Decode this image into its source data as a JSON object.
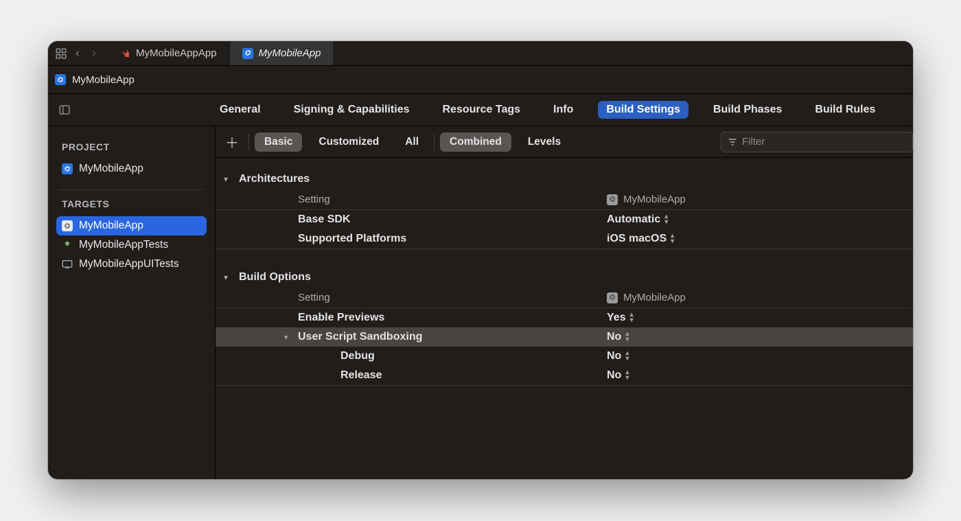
{
  "tabs": {
    "inactive_label": "MyMobileAppApp",
    "active_label": "MyMobileApp"
  },
  "project_header": {
    "title": "MyMobileApp"
  },
  "editor_tabs": {
    "general": "General",
    "signing": "Signing & Capabilities",
    "resource": "Resource Tags",
    "info": "Info",
    "build_settings": "Build Settings",
    "build_phases": "Build Phases",
    "build_rules": "Build Rules"
  },
  "sidebar": {
    "project_label": "PROJECT",
    "project_item": "MyMobileApp",
    "targets_label": "TARGETS",
    "targets": [
      "MyMobileApp",
      "MyMobileAppTests",
      "MyMobileAppUITests"
    ]
  },
  "filter_bar": {
    "basic": "Basic",
    "customized": "Customized",
    "all": "All",
    "combined": "Combined",
    "levels": "Levels",
    "placeholder": "Filter"
  },
  "settings": {
    "col_setting": "Setting",
    "col_target": "MyMobileApp",
    "architectures": {
      "title": "Architectures",
      "base_sdk": "Base SDK",
      "base_sdk_val": "Automatic",
      "supported_platforms": "Supported Platforms",
      "supported_platforms_val": "iOS macOS"
    },
    "build_options": {
      "title": "Build Options",
      "enable_previews": "Enable Previews",
      "enable_previews_val": "Yes",
      "uss": "User Script Sandboxing",
      "uss_val": "No",
      "debug": "Debug",
      "debug_val": "No",
      "release": "Release",
      "release_val": "No"
    }
  }
}
